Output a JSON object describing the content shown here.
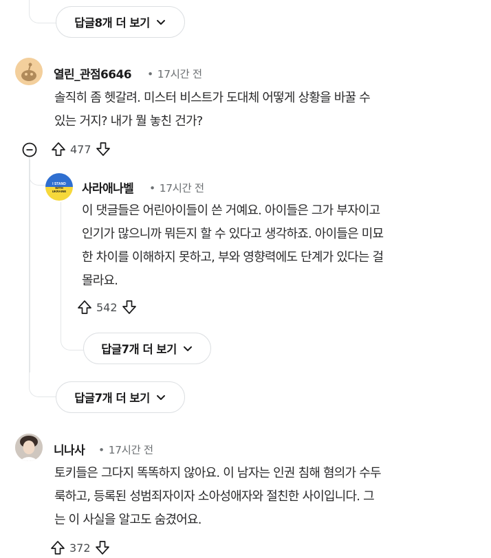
{
  "top_more": {
    "label": "답글8개 더 보기"
  },
  "comment1": {
    "username": "열린_관점6646",
    "time": "17시간 전",
    "lines": [
      "솔직히 좀 헷갈려. 미스터 비스트가 도대체 어떻게 상황을 바꿀 수",
      "있는 거지? 내가 뭘 놓친 건가?"
    ],
    "votes": "477"
  },
  "reply1": {
    "username": "사라애나벨",
    "time": "17시간 전",
    "avatar_text": "I STAND WITH UKRAINE",
    "lines": [
      "이 댓글들은 어린아이들이 쓴 거예요. 아이들은 그가 부자이고",
      "인기가 많으니까 뭐든지 할 수 있다고 생각하죠. 아이들은 미묘",
      "한 차이를 이해하지 못하고, 부와 영향력에도 단계가 있다는 걸",
      "몰라요."
    ],
    "votes": "542",
    "more_label": "답글7개 더 보기"
  },
  "comment1_more": {
    "label": "답글7개 더 보기"
  },
  "comment2": {
    "username": "니나사",
    "time": "17시간 전",
    "lines": [
      "토키들은 그다지 똑똑하지 않아요. 이 남자는 인권 침해 혐의가 수두",
      "룩하고, 등록된 성범죄자이자 소아성애자와 절친한 사이입니다. 그",
      "는 이 사실을 알고도 숨겼어요."
    ],
    "votes": "372"
  },
  "colors": {
    "line": "#e3e6e8",
    "text": "#1a1a1b",
    "meta": "#6b6f72",
    "accent_orange": "#f2a540"
  }
}
